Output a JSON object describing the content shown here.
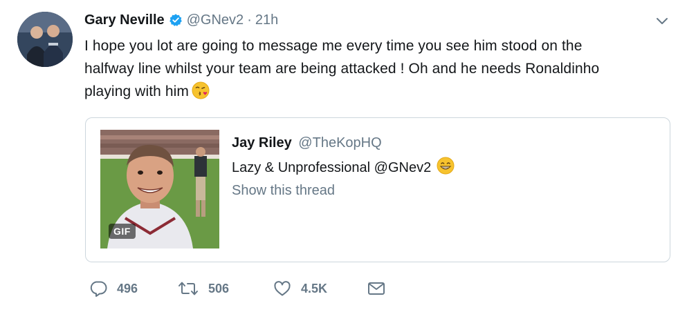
{
  "tweet": {
    "author": {
      "name": "Gary Neville",
      "handle": "@GNev2",
      "time": "21h",
      "separator": "·",
      "verified": true
    },
    "text_line1": "I hope you lot are going to message me every time you see him stood on the",
    "text_line2": "halfway line whilst your team are being attacked ! Oh and he needs Ronaldinho",
    "text_line3": "playing with him",
    "text_emoji": "face-blowing-kiss",
    "quote": {
      "author_name": "Jay Riley",
      "author_handle": "@TheKopHQ",
      "text": "Lazy & Unprofessional @GNev2",
      "text_emoji": "grinning-face",
      "thread_link": "Show this thread",
      "media_badge": "GIF"
    },
    "actions": {
      "replies": "496",
      "retweets": "506",
      "likes": "4.5K"
    },
    "icons": [
      "verified-badge-icon",
      "chevron-down-icon",
      "reply-icon",
      "retweet-icon",
      "like-icon",
      "direct-message-icon"
    ],
    "colors": {
      "verified": "#1da1f2",
      "secondary_text": "#657786",
      "border": "#ccd6dd"
    }
  }
}
